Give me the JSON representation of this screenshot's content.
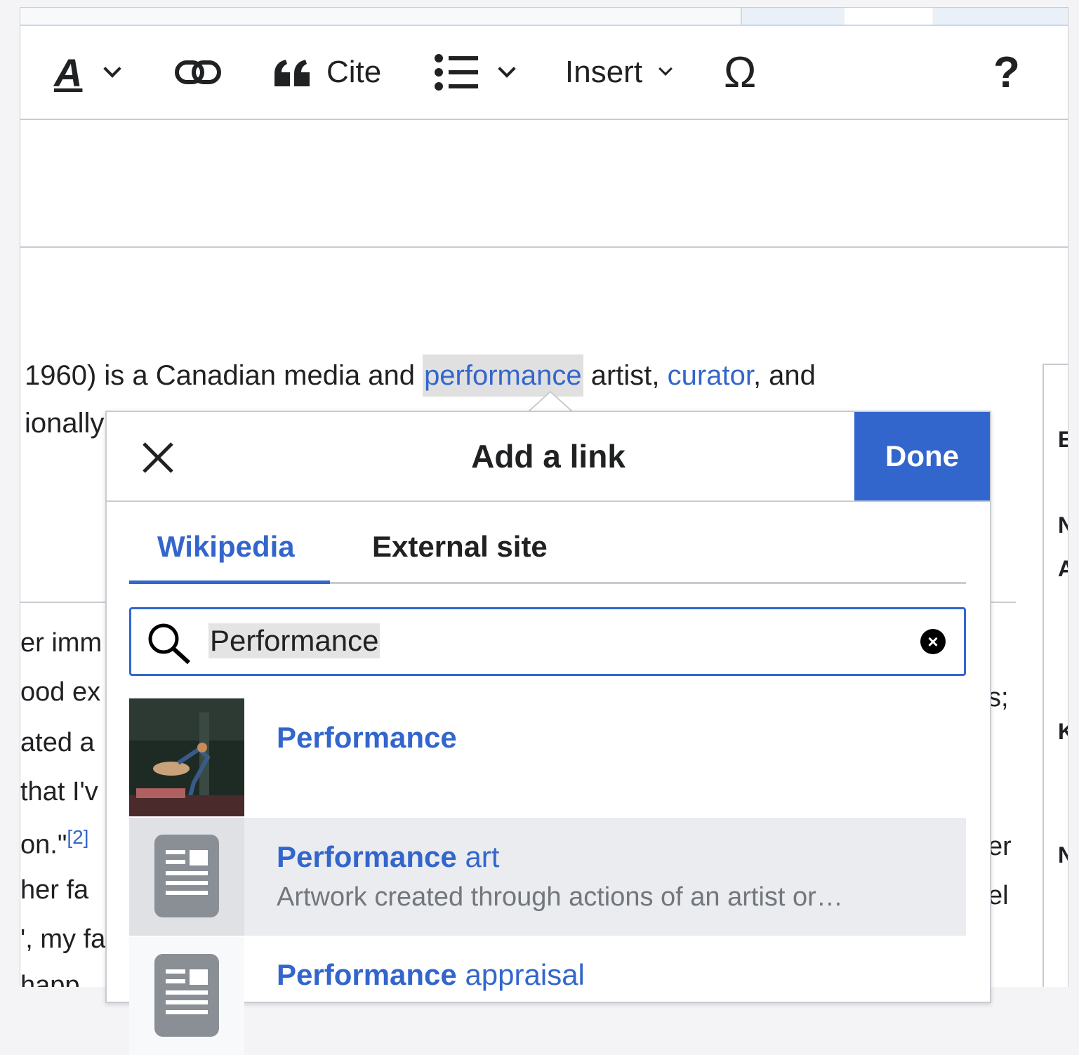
{
  "toolbar": {
    "style_icon": "A",
    "cite_label": "Cite",
    "insert_label": "Insert",
    "special_char": "Ω",
    "help": "?"
  },
  "article": {
    "line1_pre": "1960) is a Canadian media and ",
    "line1_link1": "performance",
    "line1_mid": " artist, ",
    "line1_link2": "curator",
    "line1_post": ", and",
    "line2_fragment": "ionally",
    "left_fragments": [
      "er imm",
      "ood ex",
      "ated a",
      "that I'v",
      "on.\"",
      " her fa",
      "', my fa",
      " happ"
    ],
    "citation": "[2]",
    "right_fragments": [
      "s;",
      "er",
      "el"
    ],
    "infobox_letters": [
      "E",
      "N",
      "A",
      "K",
      "N"
    ]
  },
  "dialog": {
    "title": "Add a link",
    "done_label": "Done",
    "tabs": [
      "Wikipedia",
      "External site"
    ],
    "search_value": "Performance",
    "results": [
      {
        "title_bold": "Performance",
        "title_rest": "",
        "description": ""
      },
      {
        "title_bold": "Performance",
        "title_rest": " art",
        "description": "Artwork created through actions of an artist or…"
      },
      {
        "title_bold": "Performance",
        "title_rest": " appraisal",
        "description": ""
      }
    ]
  }
}
